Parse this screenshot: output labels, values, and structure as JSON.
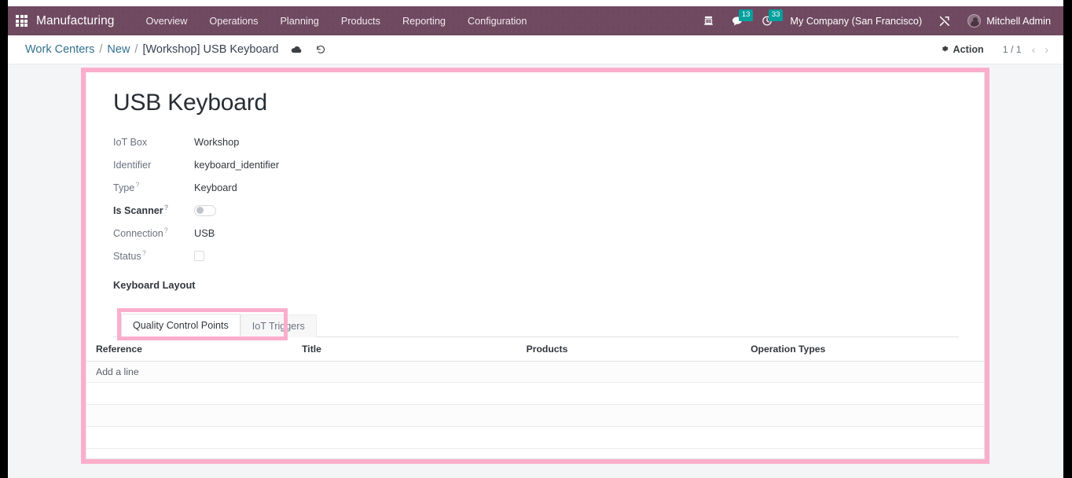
{
  "navbar": {
    "apps_icon": "apps-grid-icon",
    "brand": "Manufacturing",
    "menu": [
      {
        "label": "Overview"
      },
      {
        "label": "Operations"
      },
      {
        "label": "Planning"
      },
      {
        "label": "Products"
      },
      {
        "label": "Reporting"
      },
      {
        "label": "Configuration"
      }
    ],
    "phone_icon": "telephone-icon",
    "messages_icon": "chat-bubble-icon",
    "messages_count": "13",
    "activities_icon": "clock-icon",
    "activities_count": "33",
    "company": "My Company (San Francisco)",
    "tools_icon": "wrench-screwdriver-icon",
    "avatar": "user-avatar",
    "user": "Mitchell Admin",
    "badge_color": "#00a09d",
    "bg_color": "#6e4960"
  },
  "control_panel": {
    "breadcrumb": {
      "root": "Work Centers",
      "sep1": "/",
      "parent": "New",
      "sep2": "/",
      "current": "[Workshop] USB Keyboard"
    },
    "save_icon": "cloud-save-icon",
    "discard_icon": "undo-discard-icon",
    "action_label": "Action",
    "action_icon": "gear-icon",
    "pager": "1 / 1",
    "pager_prev_icon": "chevron-left-icon",
    "pager_next_icon": "chevron-right-icon"
  },
  "form": {
    "title": "USB Keyboard",
    "fields": [
      {
        "label": "IoT Box",
        "value": "Workshop",
        "help": false,
        "bold": false,
        "widget": "text"
      },
      {
        "label": "Identifier",
        "value": "keyboard_identifier",
        "help": false,
        "bold": false,
        "widget": "text"
      },
      {
        "label": "Type",
        "value": "Keyboard",
        "help": true,
        "bold": false,
        "widget": "text"
      },
      {
        "label": "Is Scanner",
        "value": "",
        "help": true,
        "bold": true,
        "widget": "toggle"
      },
      {
        "label": "Connection",
        "value": "USB",
        "help": true,
        "bold": false,
        "widget": "text"
      },
      {
        "label": "Status",
        "value": "",
        "help": true,
        "bold": false,
        "widget": "checkbox"
      }
    ],
    "section_heading": "Keyboard Layout",
    "help_marker": "?"
  },
  "notebook": {
    "tabs": [
      {
        "label": "Quality Control Points",
        "active": true
      },
      {
        "label": "IoT Triggers",
        "active": false
      }
    ],
    "highlight_color": "#fbaecb"
  },
  "list": {
    "columns": [
      {
        "label": "Reference"
      },
      {
        "label": "Title"
      },
      {
        "label": "Products"
      },
      {
        "label": "Operation Types"
      }
    ],
    "add_line": "Add a line",
    "rows": []
  }
}
